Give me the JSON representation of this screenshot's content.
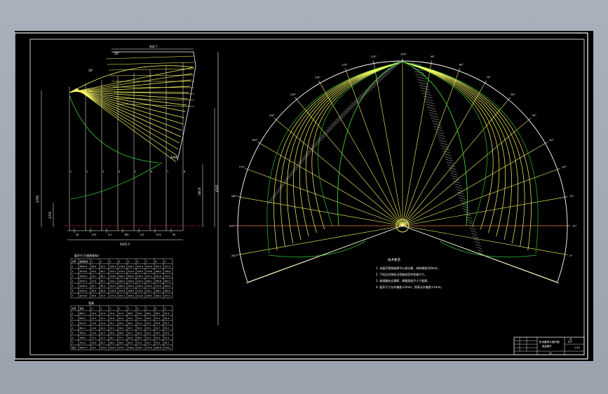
{
  "colors": {
    "background": "#000000",
    "frame": "#ffffff",
    "curve_yellow": "#ffff66",
    "curve_green": "#2fbf2f",
    "centerline_red": "#ff2a2a",
    "outer_bg": "#a3aab5"
  },
  "left_view": {
    "top_dim": "464.7",
    "top_angle": "30°",
    "left_angle": "30°",
    "side_dim_1": "4785",
    "side_dim_2": "4705",
    "inner_dim": "180.8",
    "right_dim": "4265",
    "small_dim": "4488",
    "bottom_dim": "5025.5",
    "bottom_ticks": [
      "50",
      "474",
      "4.5",
      "180",
      "4.5",
      "474",
      "50"
    ],
    "station_numbers": [
      "1",
      "2",
      "3",
      "4",
      "5",
      "6",
      "7",
      "8"
    ]
  },
  "table1": {
    "title": "展开尺寸(曲线坐标)",
    "header": [
      "点号",
      "曲线坐标",
      "1",
      "2",
      "3",
      "4",
      "5",
      "6",
      "7",
      "8",
      "9"
    ],
    "rows": [
      [
        "1",
        "4600.6",
        "45.6",
        "93.2",
        "136.4",
        "178.9",
        "216.7",
        "251.3",
        "281.8",
        "307.3",
        "327.2"
      ],
      [
        "2",
        "4512.8",
        "44.3",
        "90.7",
        "133.1",
        "174.2",
        "211.0",
        "244.8",
        "274.6",
        "299.5",
        "318.9"
      ],
      [
        "3",
        "4425.0",
        "43.1",
        "88.2",
        "129.6",
        "169.7",
        "205.6",
        "238.4",
        "267.4",
        "291.6",
        "310.5"
      ],
      [
        "4",
        "4337.2",
        "41.9",
        "85.7",
        "126.1",
        "165.0",
        "199.9",
        "231.9",
        "260.2",
        "283.8",
        "302.3"
      ],
      [
        "5",
        "4249.4",
        "40.7",
        "83.2",
        "122.5",
        "160.4",
        "194.3",
        "225.5",
        "253.0",
        "275.9",
        "293.9"
      ],
      [
        "6",
        "4161.6",
        "39.5",
        "80.8",
        "118.9",
        "155.8",
        "188.6",
        "219.0",
        "245.7",
        "268.1",
        "285.6"
      ],
      [
        "7",
        "4073.8",
        "38.3",
        "78.3",
        "115.4",
        "151.1",
        "183.0",
        "212.6",
        "238.5",
        "260.2",
        "277.2"
      ]
    ]
  },
  "table2": {
    "title": "弦高",
    "header": [
      "点号",
      "弦长",
      "1",
      "2",
      "3",
      "4",
      "5",
      "6",
      "7",
      "8",
      "9"
    ],
    "rows": [
      [
        "1",
        "850.7",
        "12.4",
        "23.6",
        "33.5",
        "41.9",
        "48.6",
        "53.6",
        "56.8",
        "58.2",
        "57.6"
      ],
      [
        "2",
        "834.2",
        "12.1",
        "23.1",
        "32.8",
        "41.0",
        "47.6",
        "52.5",
        "55.6",
        "57.0",
        "56.4"
      ],
      [
        "3",
        "817.6",
        "11.9",
        "22.6",
        "32.1",
        "40.2",
        "46.6",
        "51.4",
        "54.5",
        "55.8",
        "55.3"
      ],
      [
        "4",
        "801.1",
        "11.6",
        "22.1",
        "31.5",
        "39.4",
        "45.7",
        "50.4",
        "53.4",
        "54.7",
        "54.1"
      ],
      [
        "5",
        "784.5",
        "11.4",
        "21.7",
        "30.8",
        "38.6",
        "44.7",
        "49.3",
        "52.3",
        "53.5",
        "53.0"
      ],
      [
        "6",
        "768.0",
        "11.1",
        "21.2",
        "30.1",
        "37.7",
        "43.8",
        "48.3",
        "51.2",
        "52.4",
        "51.9"
      ],
      [
        "7",
        "751.4",
        "10.9",
        "20.7",
        "29.5",
        "36.9",
        "42.8",
        "47.2",
        "50.1",
        "51.2",
        "50.7"
      ],
      [
        "合计",
        "5607.5",
        "81.4",
        "155.0",
        "220.3",
        "275.7",
        "319.8",
        "352.7",
        "373.9",
        "382.8",
        "379.0"
      ]
    ]
  },
  "right_view": {
    "angle_labels": [
      "0°",
      "10°",
      "20°",
      "30°",
      "40°",
      "50°",
      "60°",
      "70°",
      "80°",
      "90°",
      "100°",
      "110°",
      "120°",
      "130°",
      "140°",
      "150°",
      "160°",
      "170°",
      "180°",
      "190°",
      "200°"
    ],
    "center_label": "O",
    "notes_title": "技术要求",
    "notes": [
      "1. 本展开图按板厚中心线计算，材料厚度为8mm。",
      "2. 下料后应按标记弯曲成型并检查尺寸。",
      "3. 各接缝处应满焊，焊缝高度不小于板厚。",
      "4. 展开尺寸允许偏差±2mm，弦高允许偏差±1mm。"
    ]
  },
  "title_block": {
    "drawing_name": "虾米腰弯头展开图",
    "sub_name": "钣金展开",
    "scale": "1:20",
    "sheet": "01"
  }
}
